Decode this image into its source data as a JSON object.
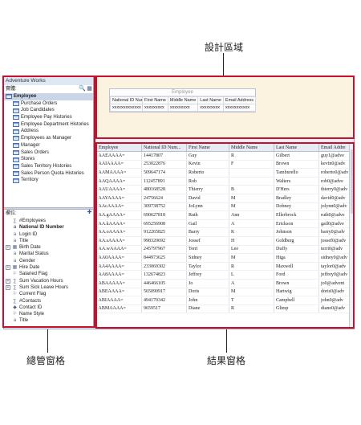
{
  "callouts": {
    "design_area": "設計區域",
    "organizer_pane": "總管窗格",
    "results_pane": "結果窗格"
  },
  "organizer": {
    "title": "Adventure Works",
    "tables_label": "實體:",
    "root_table": "Employee",
    "tables": [
      "Purchase Orders",
      "Job Candidates",
      "Employee Pay Histories",
      "Employee Department Histories",
      "Address",
      "Employees as Manager",
      "Manager",
      "Sales Orders",
      "Stores",
      "Sales Territory Histories",
      "Sales Person Quota Histories",
      "Territory"
    ],
    "columns_label": "欄位:",
    "columns": [
      {
        "label": "#Employees",
        "icon": "measure-icon",
        "bold": false,
        "expand": false
      },
      {
        "label": "National ID Number",
        "icon": "attribute-icon",
        "bold": true,
        "expand": false
      },
      {
        "label": "Login ID",
        "icon": "attribute-icon",
        "bold": false,
        "expand": false
      },
      {
        "label": "Title",
        "icon": "attribute-icon",
        "bold": false,
        "expand": false
      },
      {
        "label": "Birth Date",
        "icon": "calendar-icon",
        "bold": false,
        "expand": true
      },
      {
        "label": "Marital Status",
        "icon": "attribute-icon",
        "bold": false,
        "expand": false
      },
      {
        "label": "Gender",
        "icon": "attribute-icon",
        "bold": false,
        "expand": false
      },
      {
        "label": "Hire Date",
        "icon": "calendar-icon",
        "bold": false,
        "expand": true
      },
      {
        "label": "Salaried Flag",
        "icon": "flag-icon",
        "bold": false,
        "expand": false
      },
      {
        "label": "Sum Vacation Hours",
        "icon": "measure-icon",
        "bold": false,
        "expand": true
      },
      {
        "label": "Sum Sick Leave Hours",
        "icon": "measure-icon",
        "bold": false,
        "expand": true
      },
      {
        "label": "Current Flag",
        "icon": "flag-icon",
        "bold": false,
        "expand": false
      },
      {
        "label": "#Contacts",
        "icon": "measure-icon",
        "bold": false,
        "expand": false
      },
      {
        "label": "Contact ID",
        "icon": "key-icon",
        "bold": false,
        "expand": false
      },
      {
        "label": "Name Style",
        "icon": "flag-icon",
        "bold": false,
        "expand": false
      },
      {
        "label": "Title",
        "icon": "attribute-icon",
        "bold": false,
        "expand": false
      }
    ]
  },
  "design": {
    "entity_title": "Employee",
    "headers": [
      "National ID Number",
      "First Name",
      "Middle Name",
      "Last Name",
      "Email Address"
    ],
    "row": [
      "xxxxxxxxxxxxx",
      "xxxxxxxxx",
      "xxxxxxxxx",
      "xxxxxxxxx",
      "xxxxxxxxxxx"
    ]
  },
  "results": {
    "headers": [
      "Employee",
      "National ID Num...",
      "First Name",
      "Middle Name",
      "Last Name",
      "Email Addre"
    ],
    "rows": [
      [
        "AAEAAAA=",
        "14417807",
        "Guy",
        "R",
        "Gilbert",
        "guy1@adve"
      ],
      [
        "AAIAAAA=",
        "253022876",
        "Kevin",
        "F",
        "Brown",
        "kevin0@adv"
      ],
      [
        "AAMAAAA=",
        "509647174",
        "Roberto",
        "",
        "Tamburello",
        "roberto0@adv"
      ],
      [
        "AAQAAAA=",
        "112457891",
        "Rob",
        "",
        "Walters",
        "rob0@adve"
      ],
      [
        "AAUAAAA=",
        "480168528",
        "Thierry",
        "B",
        "D'Hers",
        "thierry0@adv"
      ],
      [
        "AAYAAAA=",
        "24756624",
        "David",
        "M",
        "Bradley",
        "david0@adv"
      ],
      [
        "AAcAAAA=",
        "309738752",
        "JoLynn",
        "M",
        "Dobney",
        "jolynn0@adv"
      ],
      [
        "AA.gAAAA=",
        "690627818",
        "Ruth",
        "Ann",
        "Ellerbrock",
        "ruth0@adve"
      ],
      [
        "AA.kAAAA=",
        "695256908",
        "Gail",
        "A",
        "Erickson",
        "gail0@adve"
      ],
      [
        "AA.oAAAA=",
        "912265825",
        "Barry",
        "K",
        "Johnson",
        "barry0@adv"
      ],
      [
        "AA.sAAAA=",
        "998320692",
        "Jossef",
        "H",
        "Goldberg",
        "jossef0@adv"
      ],
      [
        "AA.wAAAA=",
        "245797967",
        "Terri",
        "Lee",
        "Duffy",
        "terri0@adv"
      ],
      [
        "AA0AAAA=",
        "844973625",
        "Sidney",
        "M",
        "Higa",
        "sidney0@adv"
      ],
      [
        "AA4AAAA=",
        "233069302",
        "Taylor",
        "R",
        "Maxwell",
        "taylor0@adv"
      ],
      [
        "AA8AAAA=",
        "132674823",
        "Jeffrey",
        "L",
        "Ford",
        "jeffrey0@adv"
      ],
      [
        "ABAAAAA=",
        "446466105",
        "Jo",
        "A",
        "Brown",
        "jo0@advent"
      ],
      [
        "ABEAAAA=",
        "565090917",
        "Doris",
        "M",
        "Hartwig",
        "doris0@adv"
      ],
      [
        "ABIAAAA=",
        "494170342",
        "John",
        "T",
        "Campbell",
        "john0@adv"
      ],
      [
        "ABMAAAA=",
        "9659517",
        "Diane",
        "R",
        "Glimp",
        "diane0@adv"
      ]
    ]
  }
}
